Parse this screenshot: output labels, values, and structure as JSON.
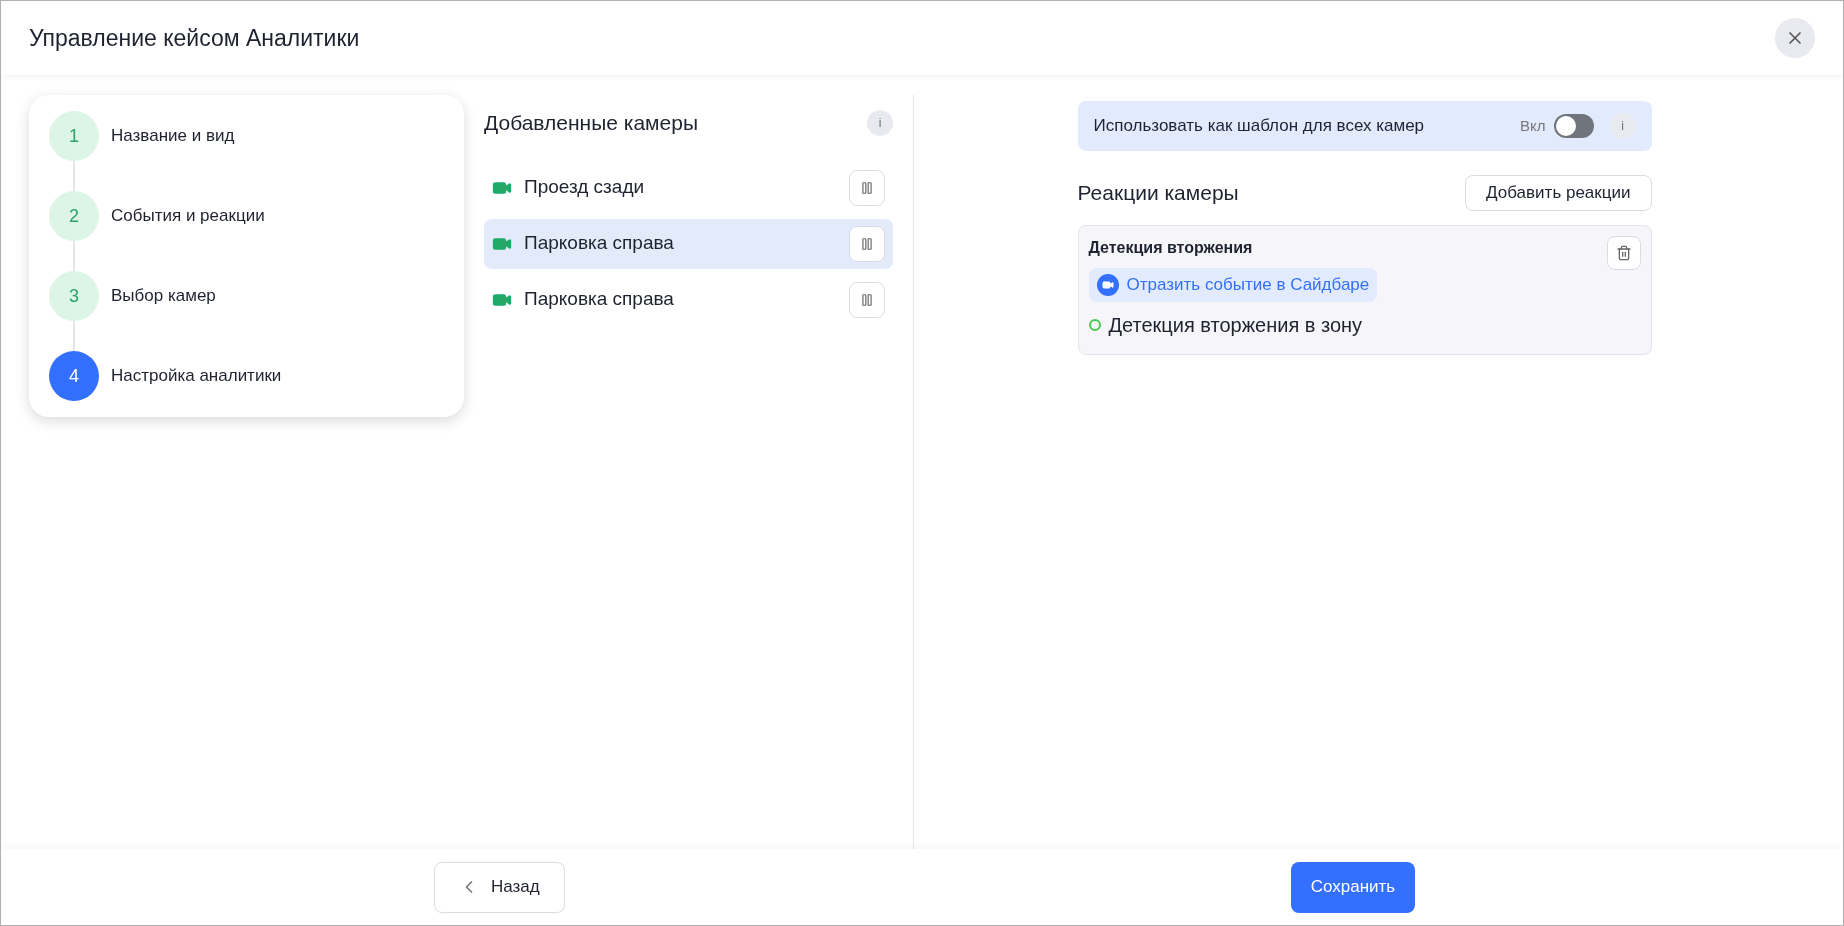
{
  "window": {
    "title": "Управление кейсом Аналитики"
  },
  "steps": [
    {
      "number": "1",
      "label": "Название и вид",
      "current": false
    },
    {
      "number": "2",
      "label": "События и реакции",
      "current": false
    },
    {
      "number": "3",
      "label": "Выбор камер",
      "current": false
    },
    {
      "number": "4",
      "label": "Настройка аналитики",
      "current": true
    }
  ],
  "cameras": {
    "title": "Добавленные камеры",
    "info": "i",
    "items": [
      {
        "name": "Проезд сзади",
        "selected": false
      },
      {
        "name": "Парковка справа",
        "selected": true
      },
      {
        "name": "Парковка справа",
        "selected": false
      }
    ]
  },
  "template": {
    "label": "Использовать как шаблон для всех камер",
    "switch_label": "Вкл",
    "on": false,
    "info": "i"
  },
  "reactions": {
    "title": "Реакции камеры",
    "add_button": "Добавить реакции",
    "items": [
      {
        "title": "Детекция вторжения",
        "action": "Отразить событие в Сайдбаре",
        "event": "Детекция вторжения в зону",
        "color": "#4cc94c"
      }
    ]
  },
  "footer": {
    "back": "Назад",
    "save": "Сохранить"
  }
}
